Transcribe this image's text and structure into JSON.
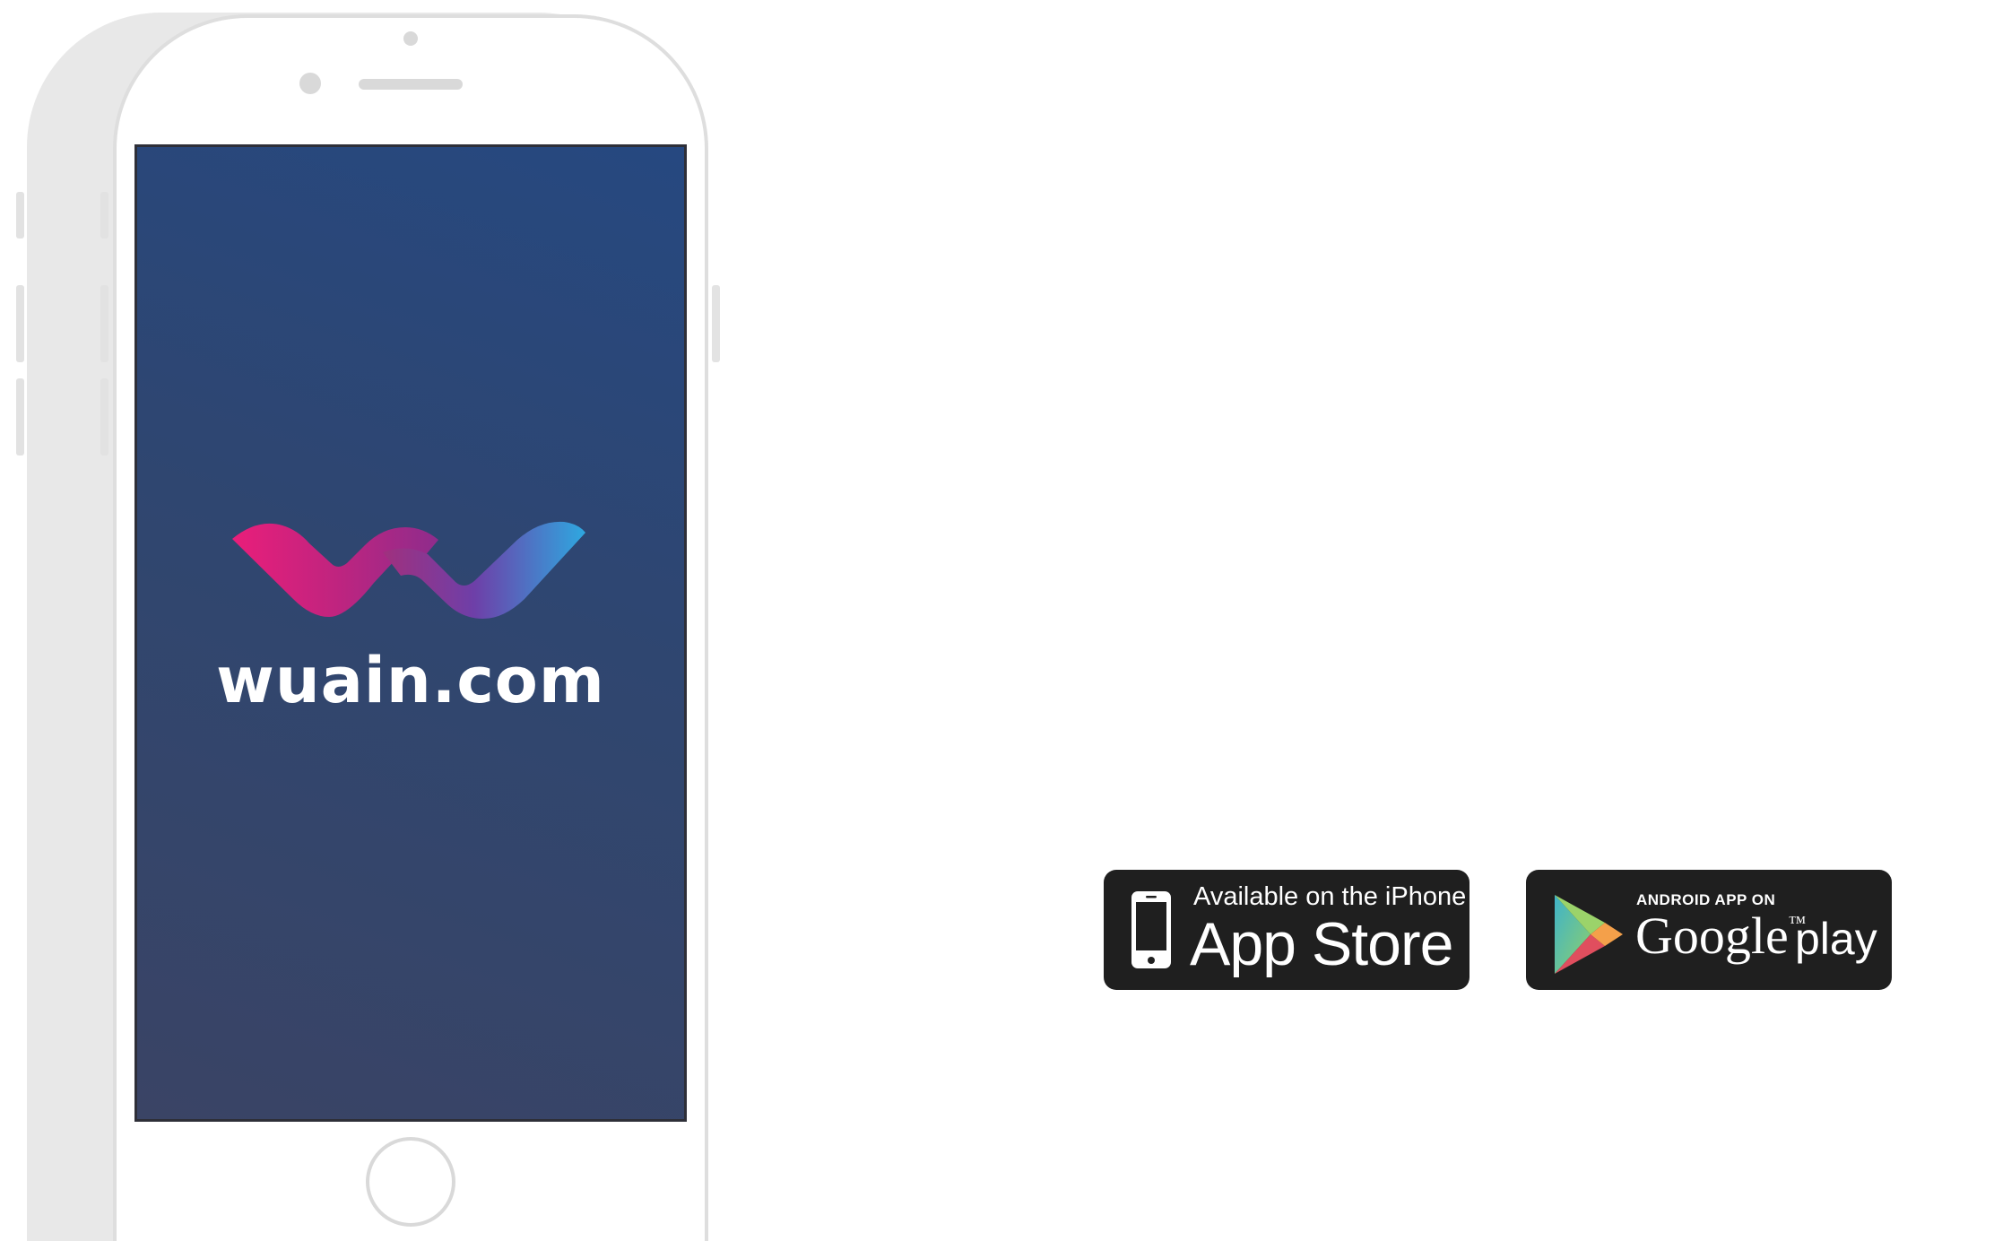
{
  "phone": {
    "screen": {
      "brand": "wuain.com",
      "logo_icon": "wuain-wave-logo-icon",
      "gradient_colors": [
        "#264880",
        "#3a4465"
      ],
      "logo_colors": [
        "#e91e7a",
        "#8a3fa0",
        "#2fa3de"
      ]
    }
  },
  "badges": {
    "app_store": {
      "small_text": "Available on the iPhone",
      "big_text": "App Store",
      "icon": "iphone-icon"
    },
    "google_play": {
      "small_text": "ANDROID APP ON",
      "big_text": "Google",
      "tm": "™",
      "play_text": "play",
      "icon": "google-play-triangle-icon"
    }
  }
}
